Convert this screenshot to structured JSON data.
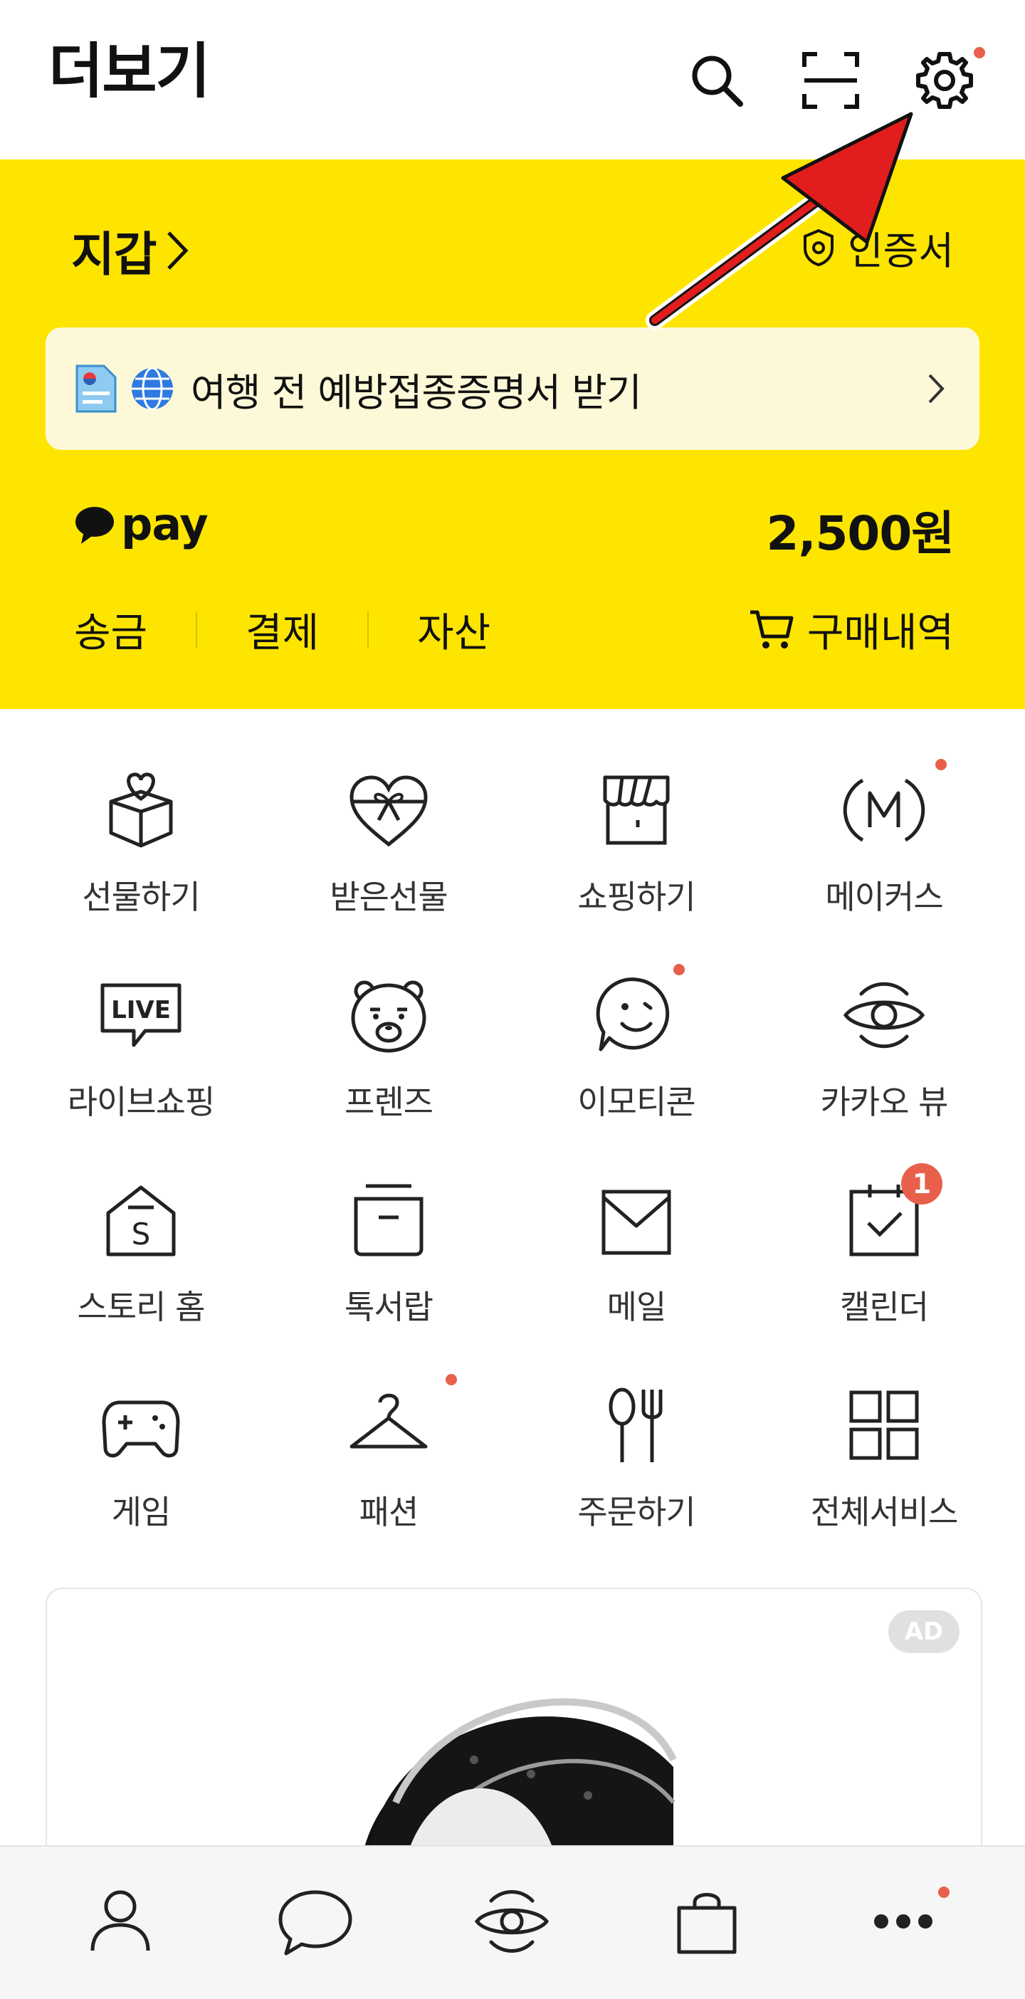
{
  "header": {
    "title": "더보기"
  },
  "wallet": {
    "title": "지갑",
    "certificate_label": "인증서",
    "banner_text": "여행 전 예방접종증명서 받기",
    "pay_logo": "pay",
    "balance": "2,500원",
    "menu": [
      "송금",
      "결제",
      "자산"
    ],
    "purchase_history": "구매내역"
  },
  "services": [
    {
      "label": "선물하기",
      "icon": "gift-box-heart-icon"
    },
    {
      "label": "받은선물",
      "icon": "heart-ribbon-icon"
    },
    {
      "label": "쇼핑하기",
      "icon": "store-icon"
    },
    {
      "label": "메이커스",
      "icon": "makers-m-icon"
    },
    {
      "label": "라이브쇼핑",
      "icon": "live-icon"
    },
    {
      "label": "프렌즈",
      "icon": "bear-face-icon"
    },
    {
      "label": "이모티콘",
      "icon": "smile-bubble-icon"
    },
    {
      "label": "카카오 뷰",
      "icon": "view-eye-icon"
    },
    {
      "label": "스토리 홈",
      "icon": "story-home-icon"
    },
    {
      "label": "톡서랍",
      "icon": "drawer-icon"
    },
    {
      "label": "메일",
      "icon": "mail-icon"
    },
    {
      "label": "캘린더",
      "icon": "calendar-icon"
    },
    {
      "label": "게임",
      "icon": "gamepad-icon"
    },
    {
      "label": "패션",
      "icon": "hanger-icon"
    },
    {
      "label": "주문하기",
      "icon": "fork-spoon-icon"
    },
    {
      "label": "전체서비스",
      "icon": "grid-icon"
    }
  ],
  "calendar_badge": "1",
  "ad": {
    "badge": "AD"
  },
  "colors": {
    "brand_yellow": "#fee500",
    "notification_dot": "#e8604c",
    "annotation_arrow": "#e11d1d"
  }
}
